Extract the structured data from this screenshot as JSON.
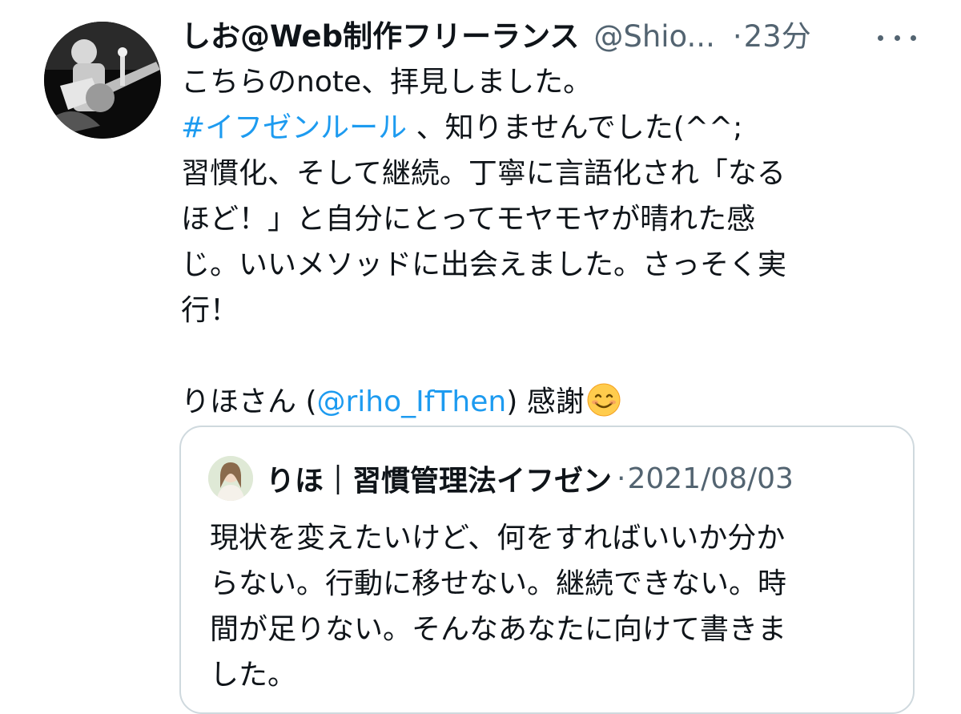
{
  "tweet": {
    "display_name": "しお@Web制作フリーランス",
    "handle": "@Shio...",
    "separator": "·",
    "time": "23分",
    "avatar_icon": "guitarist-photo-avatar",
    "lines": [
      "こちらのnote、拝見しました。",
      "#イフゼンルール",
      "、知りませんでした(^^;",
      "習慣化、そして継続。丁寧に言語化され「なる",
      "ほど！」と自分にとってモヤモヤが晴れた感",
      "じ。いいメソッドに出会えました。さっそく実",
      "行！"
    ],
    "thanks_prefix": "りほさん (",
    "mention": "@riho_IfThen",
    "thanks_suffix": ") 感謝",
    "emoji": "smiling-face-emoji"
  },
  "quote": {
    "avatar_icon": "person-photo-avatar",
    "name": "りほ｜習慣管理法イフゼン",
    "separator": "·",
    "date": "2021/08/03",
    "lines": [
      "現状を変えたいけど、何をすればいいか分か",
      "らない。行動に移せない。継続できない。時",
      "間が足りない。そんなあなたに向けて書きま",
      "した。"
    ]
  },
  "colors": {
    "text": "#0f1419",
    "secondary": "#536471",
    "link": "#1d9bf0",
    "border": "#cfd9de"
  }
}
